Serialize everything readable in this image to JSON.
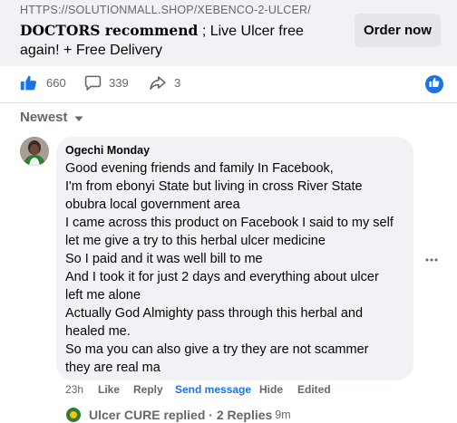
{
  "ad": {
    "url": "HTTPS://SOLUTIONMALL.SHOP/XEBENCO-2-ULCER/",
    "headline_strong": "DOCTORS recommend",
    "headline_rest": " ; Live Ulcer free again! + Free Delivery",
    "order_button": "Order now"
  },
  "stats": {
    "likes": "660",
    "comments": "339",
    "shares": "3"
  },
  "sort": {
    "label": "Newest"
  },
  "comment": {
    "author": "Ogechi Monday",
    "lines": [
      "Good evening friends and family In Facebook,",
      "I'm from ebonyi State but living in cross River State",
      "obubra local government area",
      "I came across this product on Facebook I said to my self",
      "let me give a try to this herbal ulcer medicine",
      "So I paid and it was well bill to me",
      "And I took it for just 2 days and everything about ulcer",
      "left me alone",
      "Actually God Almighty pass through this herbal and",
      "healed me.",
      "So ma you can also give a try they are not scammer",
      "they are real ma"
    ],
    "time": "23h",
    "like": "Like",
    "reply": "Reply",
    "send_message": "Send message",
    "hide": "Hide",
    "edited": "Edited"
  },
  "replies": {
    "text": "Ulcer CURE replied · 2 Replies",
    "time": "9m"
  },
  "icons": {
    "like": "thumbs-up-icon",
    "comment": "speech-bubble-icon",
    "share": "share-arrow-icon",
    "more": "more-dots-icon",
    "chevron": "chevron-down-icon"
  },
  "colors": {
    "accent": "#1b74e4",
    "muted": "#65676b",
    "bubble": "#f0f2f5"
  }
}
